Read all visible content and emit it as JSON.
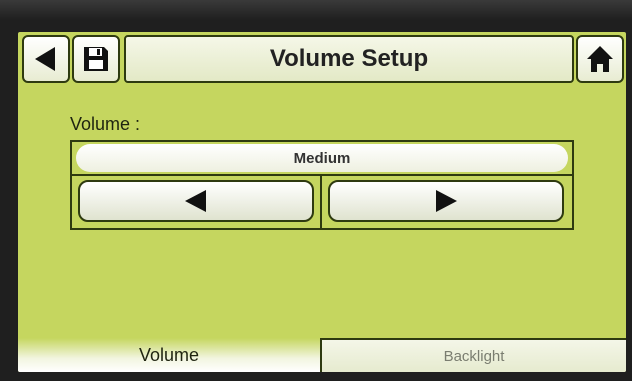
{
  "header": {
    "title": "Volume Setup",
    "back_icon": "triangle-left-icon",
    "save_icon": "floppy-disk-icon",
    "home_icon": "house-icon"
  },
  "volume": {
    "label": "Volume :",
    "value": "Medium",
    "decrease_icon": "triangle-left-icon",
    "increase_icon": "triangle-right-icon"
  },
  "tabs": [
    {
      "label": "Volume",
      "active": true
    },
    {
      "label": "Backlight",
      "active": false
    }
  ],
  "colors": {
    "screen_background": "#c5d65f",
    "outline": "#2e3a10"
  }
}
